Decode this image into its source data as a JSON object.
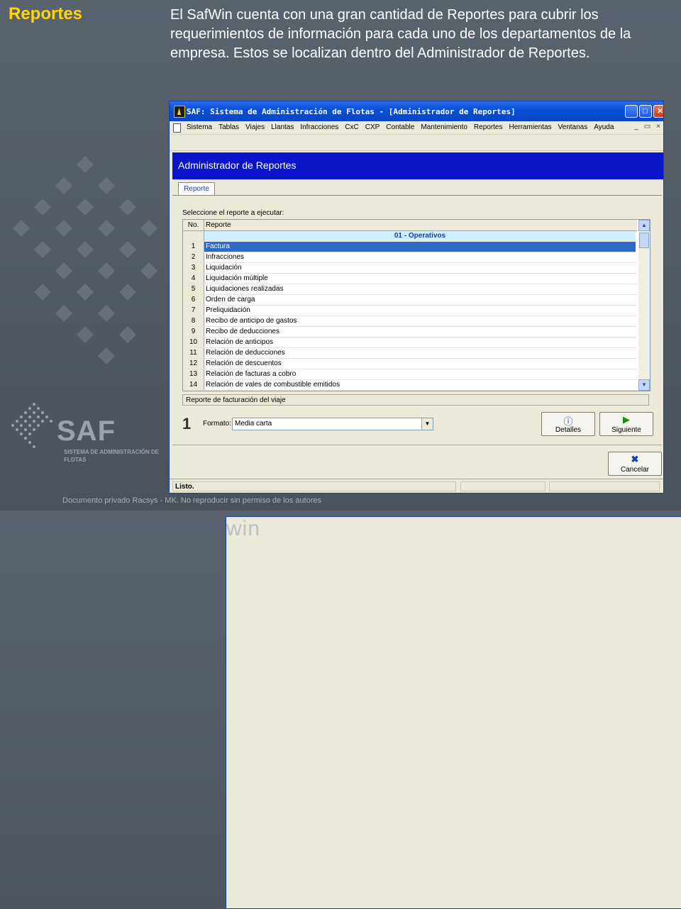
{
  "slide": {
    "title": "Reportes",
    "intro": "El SafWin cuenta con una gran cantidad de Reportes para cubrir los requerimientos de información para cada uno de los departamentos de la empresa. Estos se localizan dentro del Administrador de Reportes.",
    "logo_main": "SAF",
    "logo_win": "win",
    "logo_sub": "SISTEMA DE ADMINISTRACIÓN DE FLOTAS",
    "footer": "Documento privado Racsys - MK. No reproducir sin permiso de los autores"
  },
  "window": {
    "title": "SAF: Sistema de Administración de Flotas - [Administrador de Reportes]",
    "menu": [
      "Sistema",
      "Tablas",
      "Viajes",
      "Llantas",
      "Infracciones",
      "CxC",
      "CXP",
      "Contable",
      "Mantenimiento",
      "Reportes",
      "Herramientas",
      "Ventanas",
      "Ayuda"
    ],
    "child_controls": [
      "_",
      "▭",
      "×"
    ],
    "header": "Administrador de Reportes",
    "tab": "Reporte",
    "select_label": "Seleccione el reporte a ejecutar:",
    "grid": {
      "col_no": "No.",
      "col_report": "Reporte",
      "group": "01 - Operativos",
      "rows": [
        {
          "no": "1",
          "name": "Factura"
        },
        {
          "no": "2",
          "name": "Infracciones"
        },
        {
          "no": "3",
          "name": "Liquidación"
        },
        {
          "no": "4",
          "name": "Liquidación múltiple"
        },
        {
          "no": "5",
          "name": "Liquidaciones realizadas"
        },
        {
          "no": "6",
          "name": "Orden de carga"
        },
        {
          "no": "7",
          "name": "Preliquidación"
        },
        {
          "no": "8",
          "name": "Recibo de anticipo de gastos"
        },
        {
          "no": "9",
          "name": "Recibo de deducciones"
        },
        {
          "no": "10",
          "name": "Relación de anticipos"
        },
        {
          "no": "11",
          "name": "Relación de deducciones"
        },
        {
          "no": "12",
          "name": "Relación de descuentos"
        },
        {
          "no": "13",
          "name": "Relación de facturas a cobro"
        },
        {
          "no": "14",
          "name": "Relación de vales de combustible emitidos"
        }
      ]
    },
    "description": "Reporte de facturación del viaje",
    "big_number": "1",
    "format_label": "Formato:",
    "format_value": "Media carta",
    "buttons": {
      "details": "Detalles",
      "next": "Siguiente",
      "cancel": "Cancelar"
    },
    "status": "Listo."
  },
  "colors": {
    "title_yellow": "#ffd700",
    "header_blue": "#0a14c8",
    "selection_blue": "#316ac5",
    "group_row": "#cfefff"
  }
}
